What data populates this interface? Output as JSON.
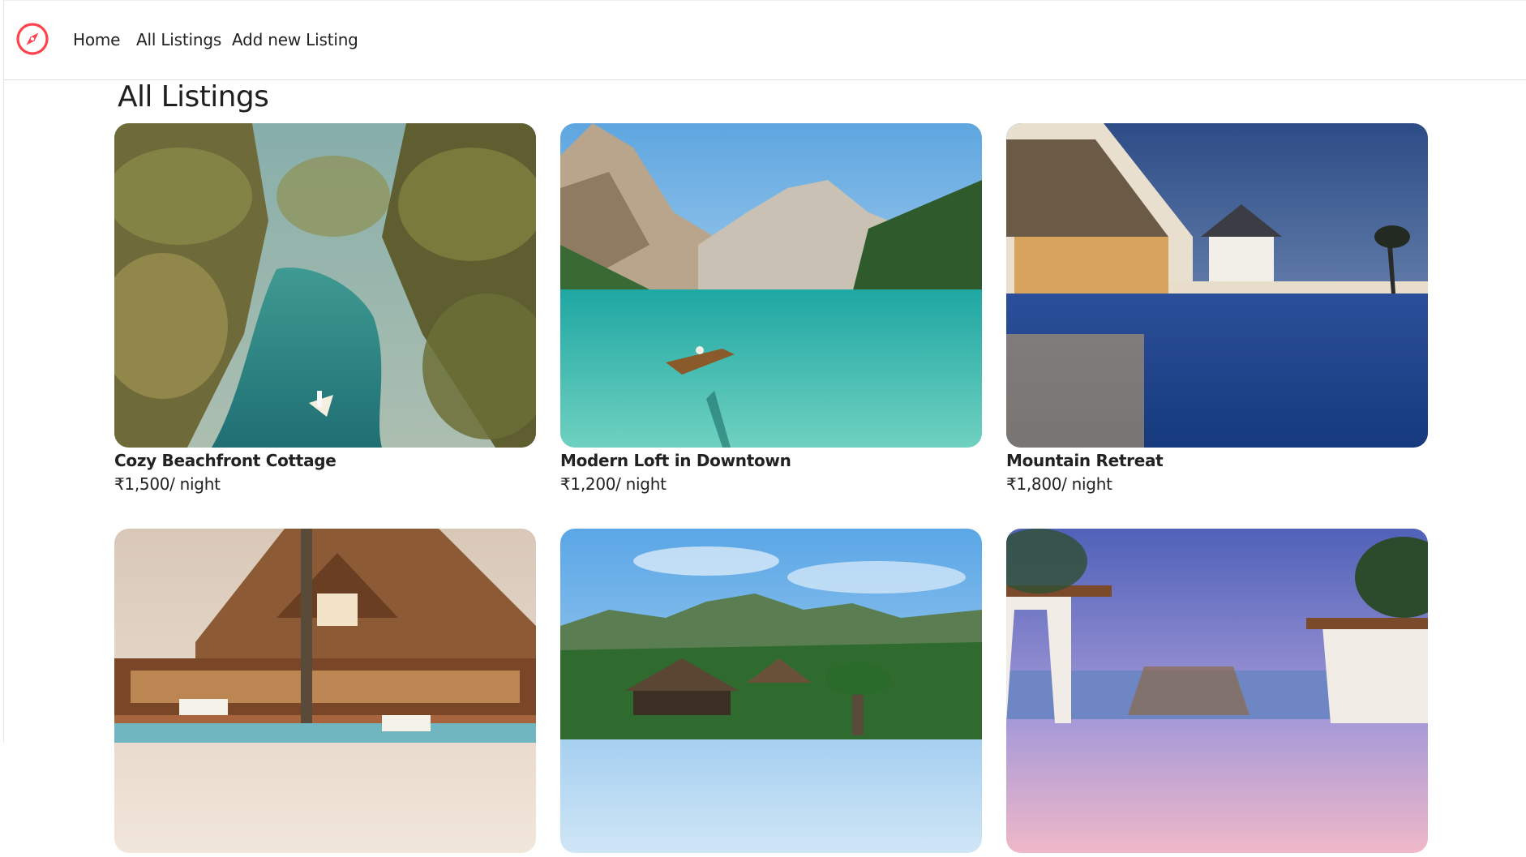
{
  "nav": {
    "logo_icon": "compass-icon",
    "accent_color": "#fe424d",
    "links": [
      {
        "label": "Home"
      },
      {
        "label": "All Listings"
      },
      {
        "label": "Add new Listing"
      }
    ]
  },
  "page": {
    "title": "All Listings"
  },
  "listings": [
    {
      "title": "Cozy Beachfront Cottage",
      "price": "₹1,500/ night",
      "image": "tropical-river-canoe-image"
    },
    {
      "title": "Modern Loft in Downtown",
      "price": "₹1,200/ night",
      "image": "mountain-lake-rowboat-image"
    },
    {
      "title": "Mountain Retreat",
      "price": "₹1,800/ night",
      "image": "resort-pool-dusk-image"
    },
    {
      "title": "",
      "price": "",
      "image": "wooden-lodge-pool-image"
    },
    {
      "title": "",
      "price": "",
      "image": "tropical-villa-mountains-image"
    },
    {
      "title": "",
      "price": "",
      "image": "cabana-sunset-sea-image"
    }
  ]
}
